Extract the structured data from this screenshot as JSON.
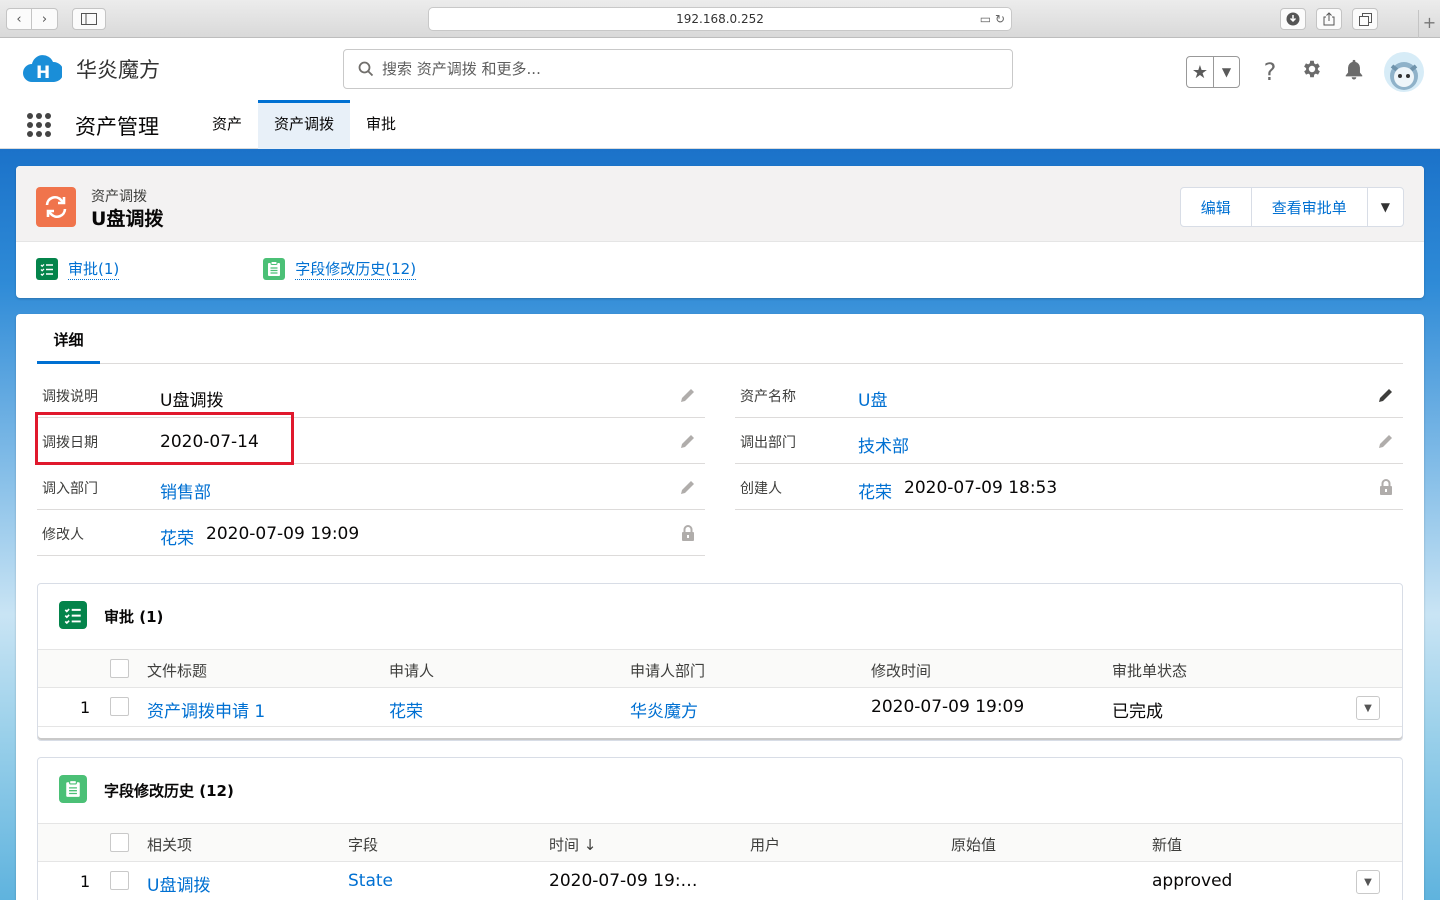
{
  "browser": {
    "url": "192.168.0.252"
  },
  "header": {
    "brand": "华炎魔方",
    "search_placeholder": "搜索 资产调拨 和更多..."
  },
  "nav": {
    "app_name": "资产管理",
    "tabs": [
      {
        "label": "资产",
        "active": false
      },
      {
        "label": "资产调拨",
        "active": true
      },
      {
        "label": "审批",
        "active": false
      }
    ]
  },
  "record": {
    "object_type": "资产调拨",
    "title": "U盘调拨",
    "actions": {
      "edit": "编辑",
      "view_approval": "查看审批单"
    },
    "related_links": [
      {
        "label": "审批(1)",
        "color": "#04844b"
      },
      {
        "label": "字段修改历史(12)",
        "color": "#4bc076"
      }
    ]
  },
  "detail": {
    "tab": "详细",
    "fields_left": [
      {
        "label": "调拨说明",
        "value": "U盘调拨"
      },
      {
        "label": "调拨日期",
        "value": "2020-07-14"
      },
      {
        "label": "调入部门",
        "value": "销售部"
      },
      {
        "label": "修改人",
        "user": "花荣",
        "time": "2020-07-09 19:09"
      }
    ],
    "fields_right": [
      {
        "label": "资产名称",
        "value": "U盘"
      },
      {
        "label": "调出部门",
        "value": "技术部"
      },
      {
        "label": "创建人",
        "user": "花荣",
        "time": "2020-07-09 18:53"
      }
    ]
  },
  "approvals": {
    "title": "审批 (1)",
    "columns": [
      "文件标题",
      "申请人",
      "申请人部门",
      "修改时间",
      "审批单状态"
    ],
    "rows": [
      {
        "num": "1",
        "title": "资产调拨申请 1",
        "applicant": "花荣",
        "dept": "华炎魔方",
        "modified": "2020-07-09 19:09",
        "status": "已完成"
      }
    ]
  },
  "history": {
    "title": "字段修改历史 (12)",
    "columns": [
      "相关项",
      "字段",
      "时间",
      "用户",
      "原始值",
      "新值"
    ],
    "sort_indicator": "↓",
    "rows": [
      {
        "num": "1",
        "related": "U盘调拨",
        "field": "State",
        "time": "2020-07-09 19:…",
        "user": "",
        "old": "",
        "new": "approved"
      }
    ]
  }
}
